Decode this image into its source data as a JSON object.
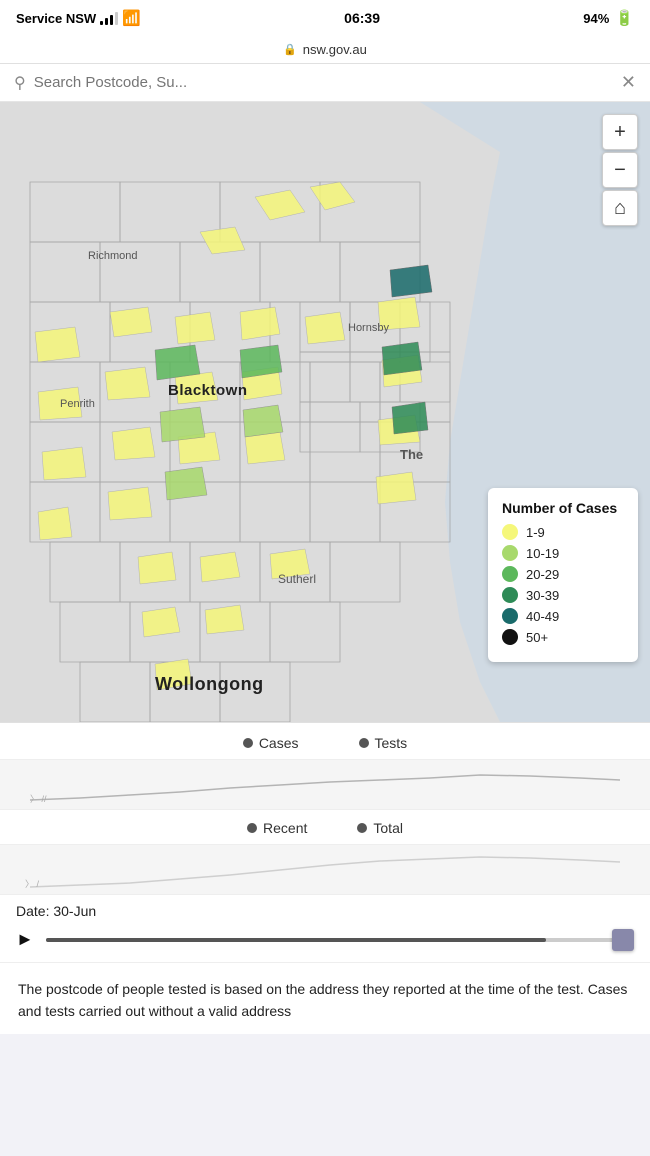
{
  "statusBar": {
    "carrier": "Service NSW",
    "time": "06:39",
    "battery": "94%"
  },
  "addressBar": {
    "url": "nsw.gov.au"
  },
  "searchBar": {
    "placeholder": "Search Postcode, Su..."
  },
  "mapControls": {
    "zoomIn": "+",
    "zoomOut": "−",
    "home": "⌂"
  },
  "legend": {
    "title": "Number of Cases",
    "items": [
      {
        "label": "1-9",
        "color": "#f5f77a"
      },
      {
        "label": "10-19",
        "color": "#a8d96c"
      },
      {
        "label": "20-29",
        "color": "#5cb85c"
      },
      {
        "label": "30-39",
        "color": "#2e8b57"
      },
      {
        "label": "40-49",
        "color": "#1a6b6b"
      },
      {
        "label": "50+",
        "color": "#111"
      }
    ]
  },
  "tabs": [
    {
      "label": "Cases",
      "dotColor": "#555"
    },
    {
      "label": "Tests",
      "dotColor": "#555"
    }
  ],
  "toggles": [
    {
      "label": "Recent",
      "dotColor": "#555"
    },
    {
      "label": "Total",
      "dotColor": "#555"
    }
  ],
  "dateLabel": "Date: 30-Jun",
  "infoText": "The postcode of people tested is based on the address they reported at the time of the test.\n Cases and tests carried out without a valid address",
  "mapLabels": {
    "richmond": "Richmond",
    "hornsby": "Hornsby",
    "penrith": "Penrith",
    "blacktown": "Blacktown",
    "the": "The",
    "sutherland": "Sutherl",
    "wollongong": "Wollongong"
  }
}
